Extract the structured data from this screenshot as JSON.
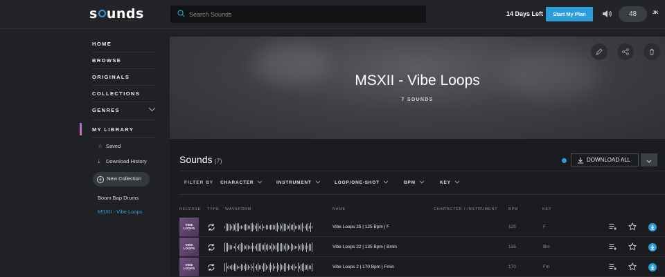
{
  "header": {
    "logo": "sounds",
    "search_placeholder": "Search Sounds",
    "trial_text": "14 Days Left",
    "start_plan_label": "Start My Plan",
    "credits": "48",
    "avatar_initials": "JK"
  },
  "sidebar": {
    "nav": [
      "HOME",
      "BROWSE",
      "ORIGINALS",
      "COLLECTIONS",
      "GENRES"
    ],
    "library_title": "MY LIBRARY",
    "library_items": [
      "Saved",
      "Download History"
    ],
    "new_collection_label": "New Collection",
    "collections": [
      "Boom Bap Drums",
      "MSXII - Vibe Loops"
    ],
    "active_collection": "MSXII - Vibe Loops",
    "accent_color": "#2d9cdb"
  },
  "hero": {
    "title": "MSXII - Vibe Loops",
    "subtitle": "7 SOUNDS",
    "actions": [
      "pencil-icon",
      "share-icon",
      "trash-icon"
    ]
  },
  "sounds_section": {
    "title": "Sounds",
    "count": "(7)",
    "download_all_label": "DOWNLOAD ALL",
    "filter_label": "FILTER BY",
    "filters": [
      "CHARACTER",
      "INSTRUMENT",
      "LOOP/ONE-SHOT",
      "BPM",
      "KEY"
    ],
    "columns": [
      "RELEASE",
      "TYPE",
      "WAVEFORM",
      "NAME",
      "CHARACTER / INSTRUMENT",
      "BPM",
      "KEY"
    ],
    "rows": [
      {
        "release_line1": "VIBE LOOPS",
        "release_line2": "∴",
        "name": "Vibe Loops 25 | 125 Bpm | F",
        "bpm": "125",
        "key": "F"
      },
      {
        "release_line1": "VIBE LOOPS",
        "release_line2": "∴",
        "name": "Vibe Loops 22 | 135 Bpm | Bmin",
        "bpm": "135",
        "key": "Bm"
      },
      {
        "release_line1": "VIBE LOOPS",
        "release_line2": "∴",
        "name": "Vibe Loops 2 | 170 Bpm | Fmin",
        "bpm": "170",
        "key": "Fm"
      }
    ]
  }
}
